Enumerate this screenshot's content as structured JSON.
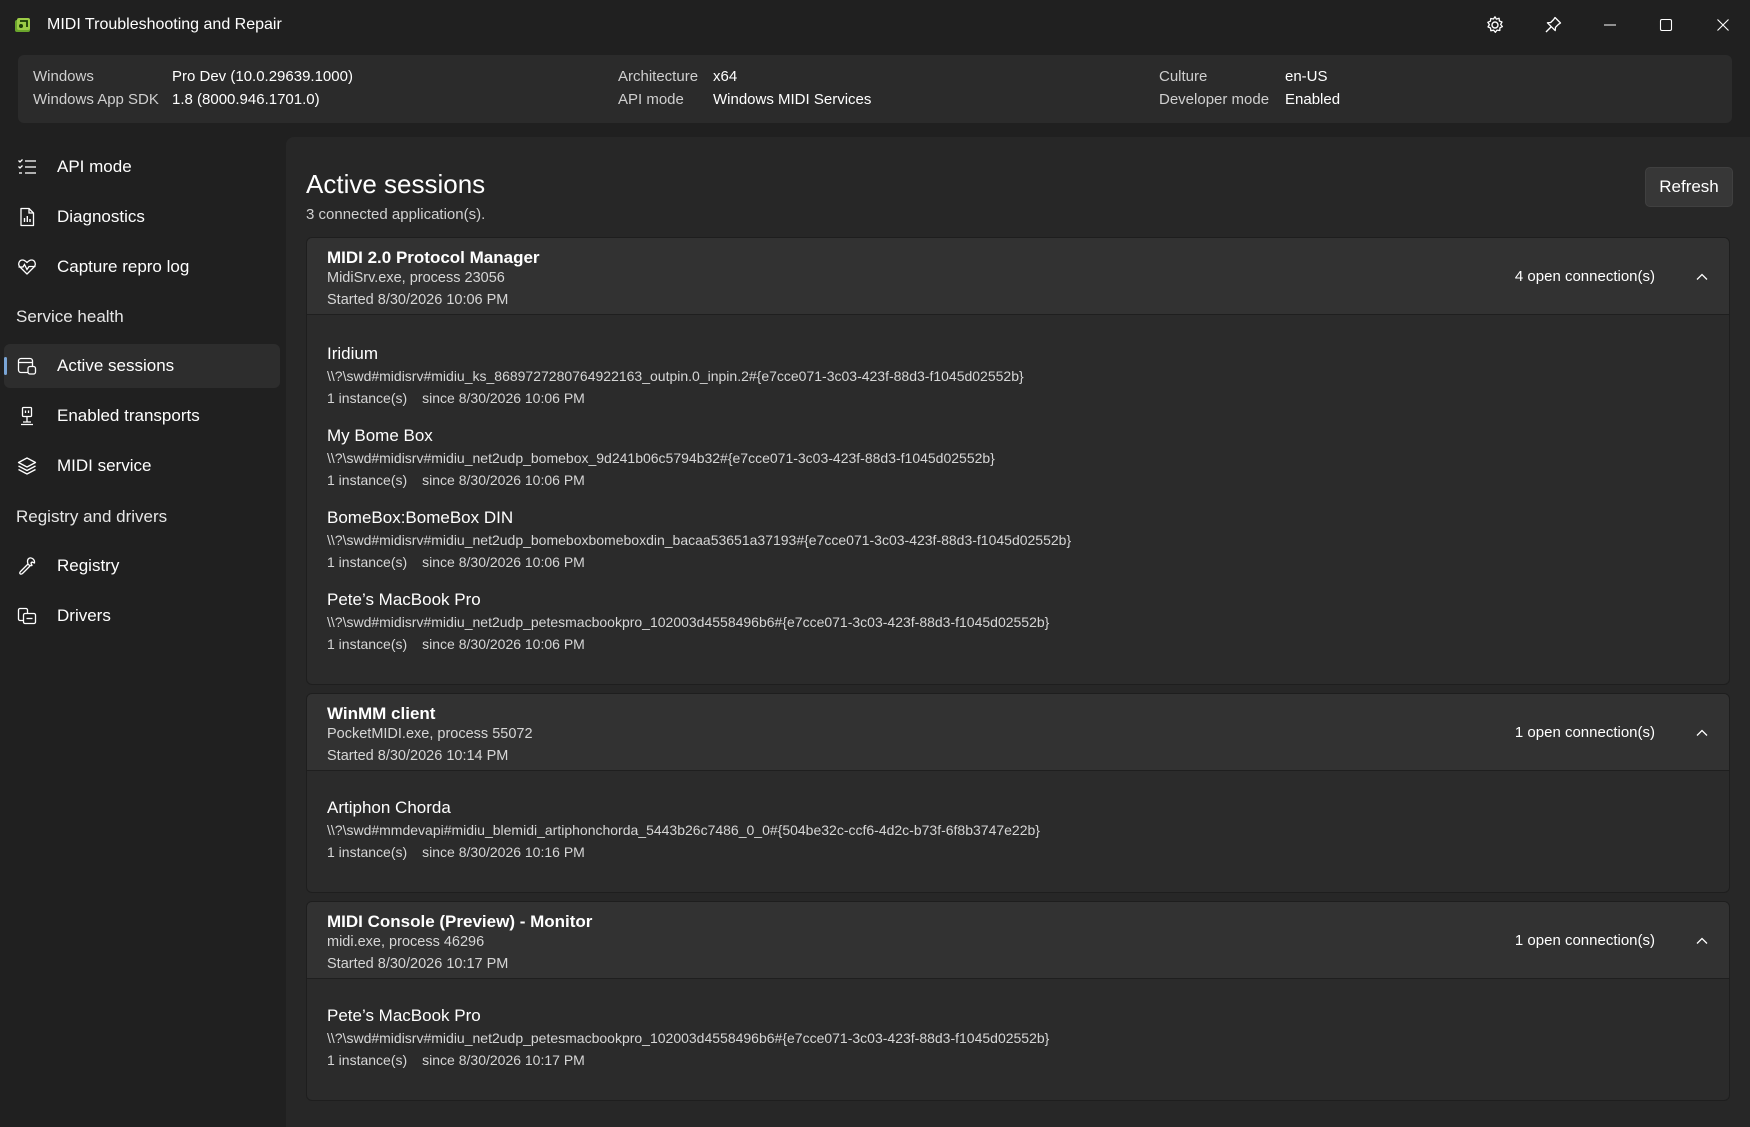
{
  "window": {
    "title": "MIDI Troubleshooting and Repair",
    "icons": [
      "app-icon",
      "settings-icon",
      "pin-icon",
      "minimize-icon",
      "maximize-icon",
      "close-icon"
    ]
  },
  "info": {
    "windows_label": "Windows",
    "windows_value": "Pro Dev (10.0.29639.1000)",
    "sdk_label": "Windows App SDK",
    "sdk_value": "1.8 (8000.946.1701.0)",
    "arch_label": "Architecture",
    "arch_value": "x64",
    "api_label": "API mode",
    "api_value": "Windows MIDI Services",
    "culture_label": "Culture",
    "culture_value": "en-US",
    "devmode_label": "Developer mode",
    "devmode_value": "Enabled"
  },
  "sidebar": {
    "api_mode": "API mode",
    "diagnostics": "Diagnostics",
    "capture_repro_log": "Capture repro log",
    "service_health_header": "Service health",
    "active_sessions": "Active sessions",
    "enabled_transports": "Enabled transports",
    "midi_service": "MIDI service",
    "registry_drivers_header": "Registry and drivers",
    "registry": "Registry",
    "drivers": "Drivers",
    "selected": "Active sessions"
  },
  "main": {
    "title": "Active sessions",
    "subtitle": "3 connected application(s).",
    "refresh_label": "Refresh",
    "sessions": [
      {
        "name": "MIDI 2.0 Protocol Manager",
        "process": "MidiSrv.exe, process 23056",
        "started": "Started 8/30/2026 10:06 PM",
        "connection_count": "4 open connection(s)",
        "connections": [
          {
            "name": "Iridium",
            "id": "\\\\?\\swd#midisrv#midiu_ks_8689727280764922163_outpin.0_inpin.2#{e7cce071-3c03-423f-88d3-f1045d02552b}",
            "instances": "1 instance(s)",
            "since": "since 8/30/2026 10:06 PM"
          },
          {
            "name": "My Bome Box",
            "id": "\\\\?\\swd#midisrv#midiu_net2udp_bomebox_9d241b06c5794b32#{e7cce071-3c03-423f-88d3-f1045d02552b}",
            "instances": "1 instance(s)",
            "since": "since 8/30/2026 10:06 PM"
          },
          {
            "name": "BomeBox:BomeBox DIN",
            "id": "\\\\?\\swd#midisrv#midiu_net2udp_bomeboxbomeboxdin_bacaa53651a37193#{e7cce071-3c03-423f-88d3-f1045d02552b}",
            "instances": "1 instance(s)",
            "since": "since 8/30/2026 10:06 PM"
          },
          {
            "name": "Pete’s MacBook Pro",
            "id": "\\\\?\\swd#midisrv#midiu_net2udp_petesmacbookpro_102003d4558496b6#{e7cce071-3c03-423f-88d3-f1045d02552b}",
            "instances": "1 instance(s)",
            "since": "since 8/30/2026 10:06 PM"
          }
        ]
      },
      {
        "name": "WinMM client",
        "process": "PocketMIDI.exe, process 55072",
        "started": "Started 8/30/2026 10:14 PM",
        "connection_count": "1 open connection(s)",
        "connections": [
          {
            "name": "Artiphon Chorda",
            "id": "\\\\?\\swd#mmdevapi#midiu_blemidi_artiphonchorda_5443b26c7486_0_0#{504be32c-ccf6-4d2c-b73f-6f8b3747e22b}",
            "instances": "1 instance(s)",
            "since": "since 8/30/2026 10:16 PM"
          }
        ]
      },
      {
        "name": "MIDI Console (Preview) - Monitor",
        "process": "midi.exe, process 46296",
        "started": "Started 8/30/2026 10:17 PM",
        "connection_count": "1 open connection(s)",
        "connections": [
          {
            "name": "Pete’s MacBook Pro",
            "id": "\\\\?\\swd#midisrv#midiu_net2udp_petesmacbookpro_102003d4558496b6#{e7cce071-3c03-423f-88d3-f1045d02552b}",
            "instances": "1 instance(s)",
            "since": "since 8/30/2026 10:17 PM"
          }
        ]
      }
    ]
  },
  "colors": {
    "background": "#202020",
    "panel": "#2b2b2b",
    "selection_accent": "#7aa5d6",
    "app_icon_green": "#8bc34a"
  }
}
